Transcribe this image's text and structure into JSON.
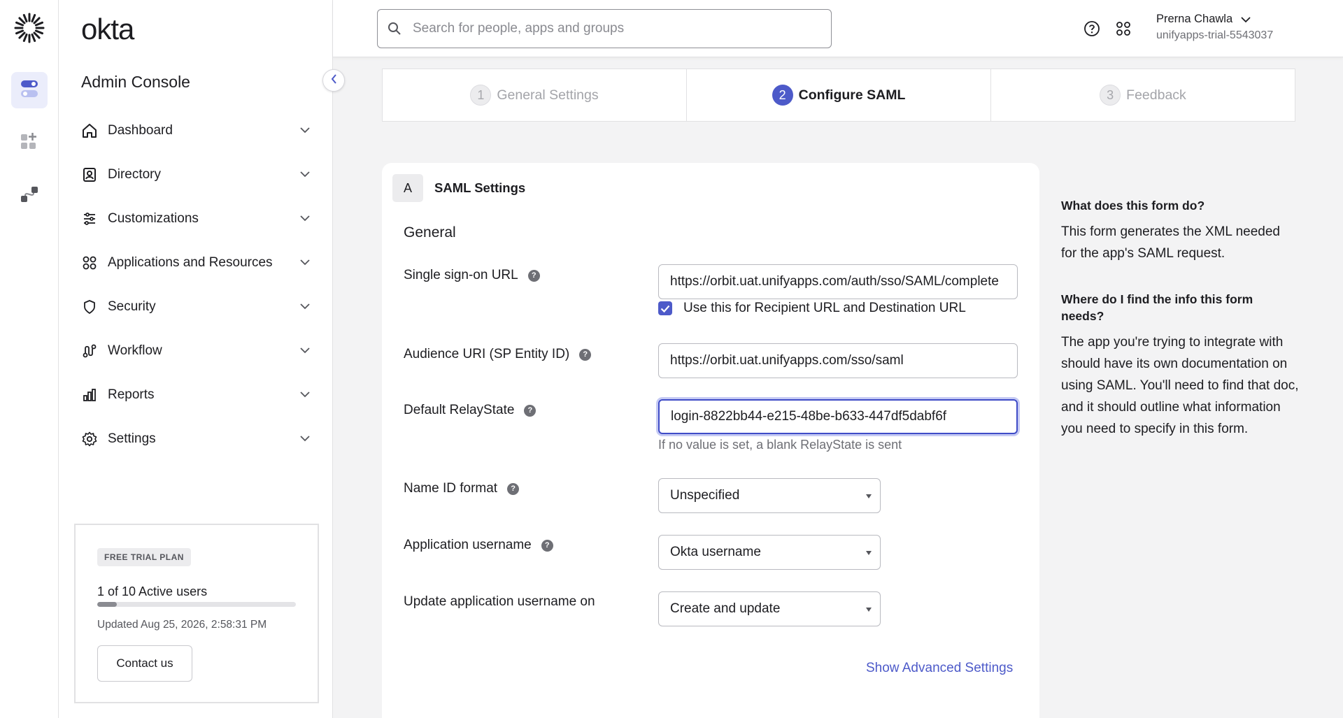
{
  "brand": {
    "wordmark": "okta",
    "accent": "#4d5ac9"
  },
  "rail": {
    "items": [
      {
        "icon": "toggle-apps-icon",
        "active": true
      },
      {
        "icon": "add-apps-icon",
        "active": false
      },
      {
        "icon": "integrations-icon",
        "active": false
      }
    ]
  },
  "sidebar": {
    "title": "Admin Console",
    "items": [
      {
        "label": "Dashboard",
        "icon": "home-icon"
      },
      {
        "label": "Directory",
        "icon": "directory-icon"
      },
      {
        "label": "Customizations",
        "icon": "sliders-icon"
      },
      {
        "label": "Applications and Resources",
        "icon": "grid-icon"
      },
      {
        "label": "Security",
        "icon": "shield-icon"
      },
      {
        "label": "Workflow",
        "icon": "workflow-icon"
      },
      {
        "label": "Reports",
        "icon": "bar-chart-icon"
      },
      {
        "label": "Settings",
        "icon": "gear-icon"
      }
    ],
    "trial": {
      "badge": "FREE TRIAL PLAN",
      "users": "1 of 10 Active users",
      "users_fraction": 0.1,
      "updated": "Updated Aug 25, 2026, 2:58:31 PM",
      "contact_label": "Contact us"
    }
  },
  "topbar": {
    "search_placeholder": "Search for people, apps and groups",
    "user_name": "Prerna Chawla",
    "org": "unifyapps-trial-5543037"
  },
  "stepper": {
    "steps": [
      {
        "num": "1",
        "label": "General Settings",
        "state": "inactive"
      },
      {
        "num": "2",
        "label": "Configure SAML",
        "state": "active"
      },
      {
        "num": "3",
        "label": "Feedback",
        "state": "inactive"
      }
    ]
  },
  "form": {
    "section_tag": "A",
    "section_title": "SAML Settings",
    "group_title": "General",
    "sso_url": {
      "label": "Single sign-on URL",
      "value": "https://orbit.uat.unifyapps.com/auth/sso/SAML/complete"
    },
    "recipient_checkbox": {
      "label": "Use this for Recipient URL and Destination URL",
      "checked": true
    },
    "audience_uri": {
      "label": "Audience URI (SP Entity ID)",
      "value": "https://orbit.uat.unifyapps.com/sso/saml"
    },
    "relay_state": {
      "label": "Default RelayState",
      "value": "login-8822bb44-e215-48be-b633-447df5dabf6f",
      "hint": "If no value is set, a blank RelayState is sent"
    },
    "name_id_format": {
      "label": "Name ID format",
      "value": "Unspecified"
    },
    "app_username": {
      "label": "Application username",
      "value": "Okta username"
    },
    "update_username_on": {
      "label": "Update application username on",
      "value": "Create and update"
    },
    "advanced_link": "Show Advanced Settings"
  },
  "help": {
    "q1": "What does this form do?",
    "a1": "This form generates the XML needed for the app's SAML request.",
    "q2": "Where do I find the info this form needs?",
    "a2": "The app you're trying to integrate with should have its own documentation on using SAML. You'll need to find that doc, and it should outline what information you need to specify in this form."
  }
}
